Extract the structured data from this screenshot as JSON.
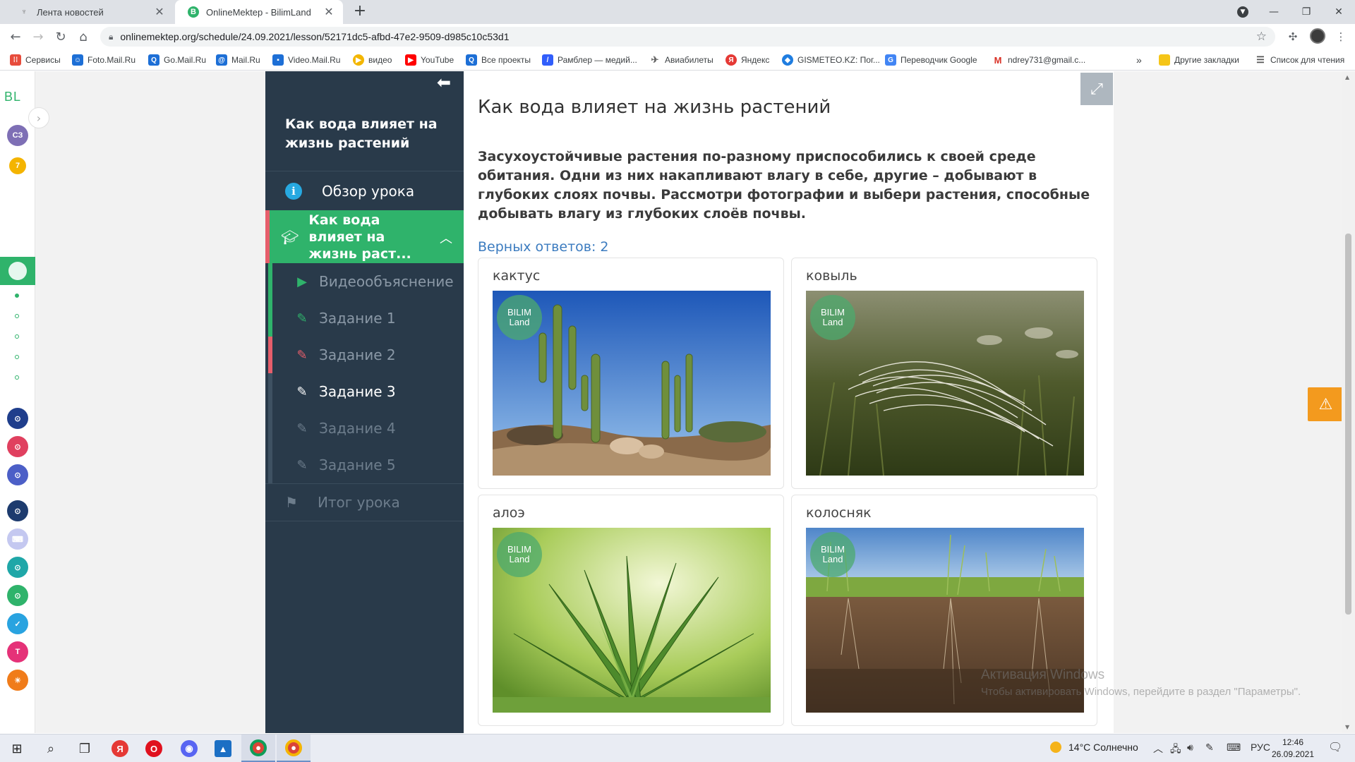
{
  "browser": {
    "tabs": [
      {
        "title": "Лента новостей",
        "active": false
      },
      {
        "title": "OnlineMektep - BilimLand",
        "active": true
      }
    ],
    "url": "onlinemektep.org/schedule/24.09.2021/lesson/52171dc5-afbd-47e2-9509-d985c10c53d1",
    "bookmarks": [
      {
        "label": "Сервисы",
        "icon": "apps-grid-icon",
        "color": "#e74c3c"
      },
      {
        "label": "Foto.Mail.Ru",
        "icon": "foto-mail-icon",
        "color": "#1d6fd6"
      },
      {
        "label": "Go.Mail.Ru",
        "icon": "search-mail-icon",
        "color": "#1d6fd6"
      },
      {
        "label": "Mail.Ru",
        "icon": "mail-ru-icon",
        "color": "#1d6fd6"
      },
      {
        "label": "Video.Mail.Ru",
        "icon": "video-mail-icon",
        "color": "#1d6fd6"
      },
      {
        "label": "видео",
        "icon": "video-icon",
        "color": "#f3b600"
      },
      {
        "label": "YouTube",
        "icon": "youtube-icon",
        "color": "#ff0000"
      },
      {
        "label": "Все проекты",
        "icon": "all-projects-icon",
        "color": "#1d6fd6"
      },
      {
        "label": "Рамблер — медий...",
        "icon": "rambler-icon",
        "color": "#315efb"
      },
      {
        "label": "Авиабилеты",
        "icon": "plane-icon",
        "color": "#888"
      },
      {
        "label": "Яндекс",
        "icon": "yandex-icon",
        "color": "#e53935"
      },
      {
        "label": "GISMETEO.KZ: Пог...",
        "icon": "gismeteo-icon",
        "color": "#1f7de0"
      },
      {
        "label": "Переводчик Google",
        "icon": "translate-icon",
        "color": "#4285f4"
      },
      {
        "label": "ndrey731@gmail.c...",
        "icon": "gmail-icon",
        "color": "#d93025"
      }
    ],
    "more_bookmarks": "»",
    "other_bookmarks": "Другие закладки",
    "reading_list": "Список для чтения"
  },
  "rail": {
    "logo": "BL",
    "user_initials": "СЗ",
    "notification_count": "7"
  },
  "lesson": {
    "sidebar_title": "Как вода влияет на жизнь растений",
    "overview": "Обзор урока",
    "current_section": "Как вода влияет на жизнь раст...",
    "items": [
      {
        "label": "Видеообъяснение",
        "icon": "play-icon",
        "status": "done"
      },
      {
        "label": "Задание 1",
        "icon": "edit-icon",
        "status": "correct"
      },
      {
        "label": "Задание 2",
        "icon": "edit-icon",
        "status": "wrong"
      },
      {
        "label": "Задание 3",
        "icon": "edit-icon",
        "status": "current"
      },
      {
        "label": "Задание 4",
        "icon": "edit-icon",
        "status": "locked"
      },
      {
        "label": "Задание 5",
        "icon": "edit-icon",
        "status": "locked"
      }
    ],
    "summary": "Итог урока"
  },
  "content": {
    "title": "Как вода влияет на жизнь растений",
    "task": "Засухоустойчивые растения по-разному приспособились к своей среде обитания. Одни из них накапливают влагу в себе, другие – добывают в глубоких слоях почвы. Рассмотри фотографии и выбери растения, способные добывать влагу из глубоких слоёв почвы.",
    "correct_answers": "Верных ответов: 2",
    "cards": [
      {
        "name": "кактус"
      },
      {
        "name": "ковыль"
      },
      {
        "name": "алоэ"
      },
      {
        "name": "колосняк"
      }
    ],
    "badge_line1": "BILIM",
    "badge_line2": "Land"
  },
  "watermark": {
    "line1": "Активация Windows",
    "line2": "Чтобы активировать Windows, перейдите в раздел \"Параметры\"."
  },
  "taskbar": {
    "weather": "14°C  Солнечно",
    "lang": "РУС",
    "time": "12:46",
    "date": "26.09.2021"
  },
  "colors": {
    "accent_green": "#2fb36b",
    "sidebar_bg": "#293a4a",
    "error_red": "#e65e6b",
    "link_blue": "#3b7bbf",
    "warning_orange": "#f39a1e"
  }
}
